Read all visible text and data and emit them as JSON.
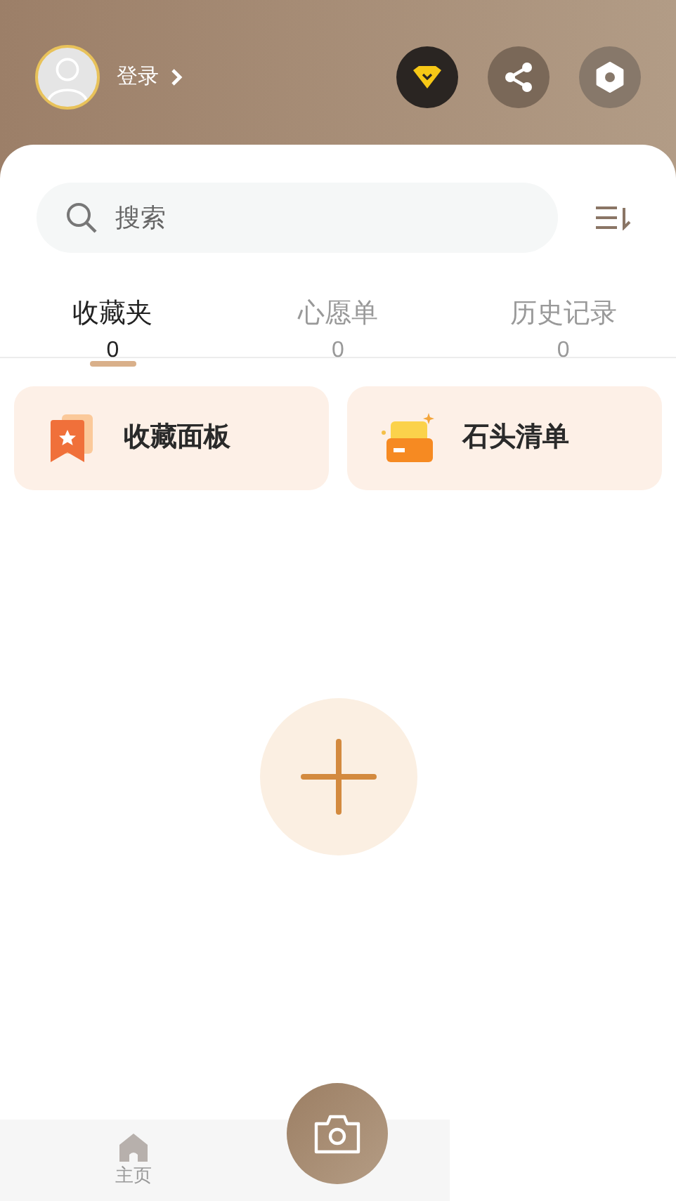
{
  "header": {
    "login": "登录"
  },
  "search": {
    "placeholder": "搜索"
  },
  "tabs": [
    {
      "label": "收藏夹",
      "count": "0",
      "selected": true
    },
    {
      "label": "心愿单",
      "count": "0",
      "selected": false
    },
    {
      "label": "历史记录",
      "count": "0",
      "selected": false
    }
  ],
  "cards": [
    {
      "kind": "board",
      "label": "收藏面板"
    },
    {
      "kind": "list",
      "label": "石头清单"
    }
  ],
  "bottom_nav": [
    {
      "label": "主页"
    }
  ]
}
